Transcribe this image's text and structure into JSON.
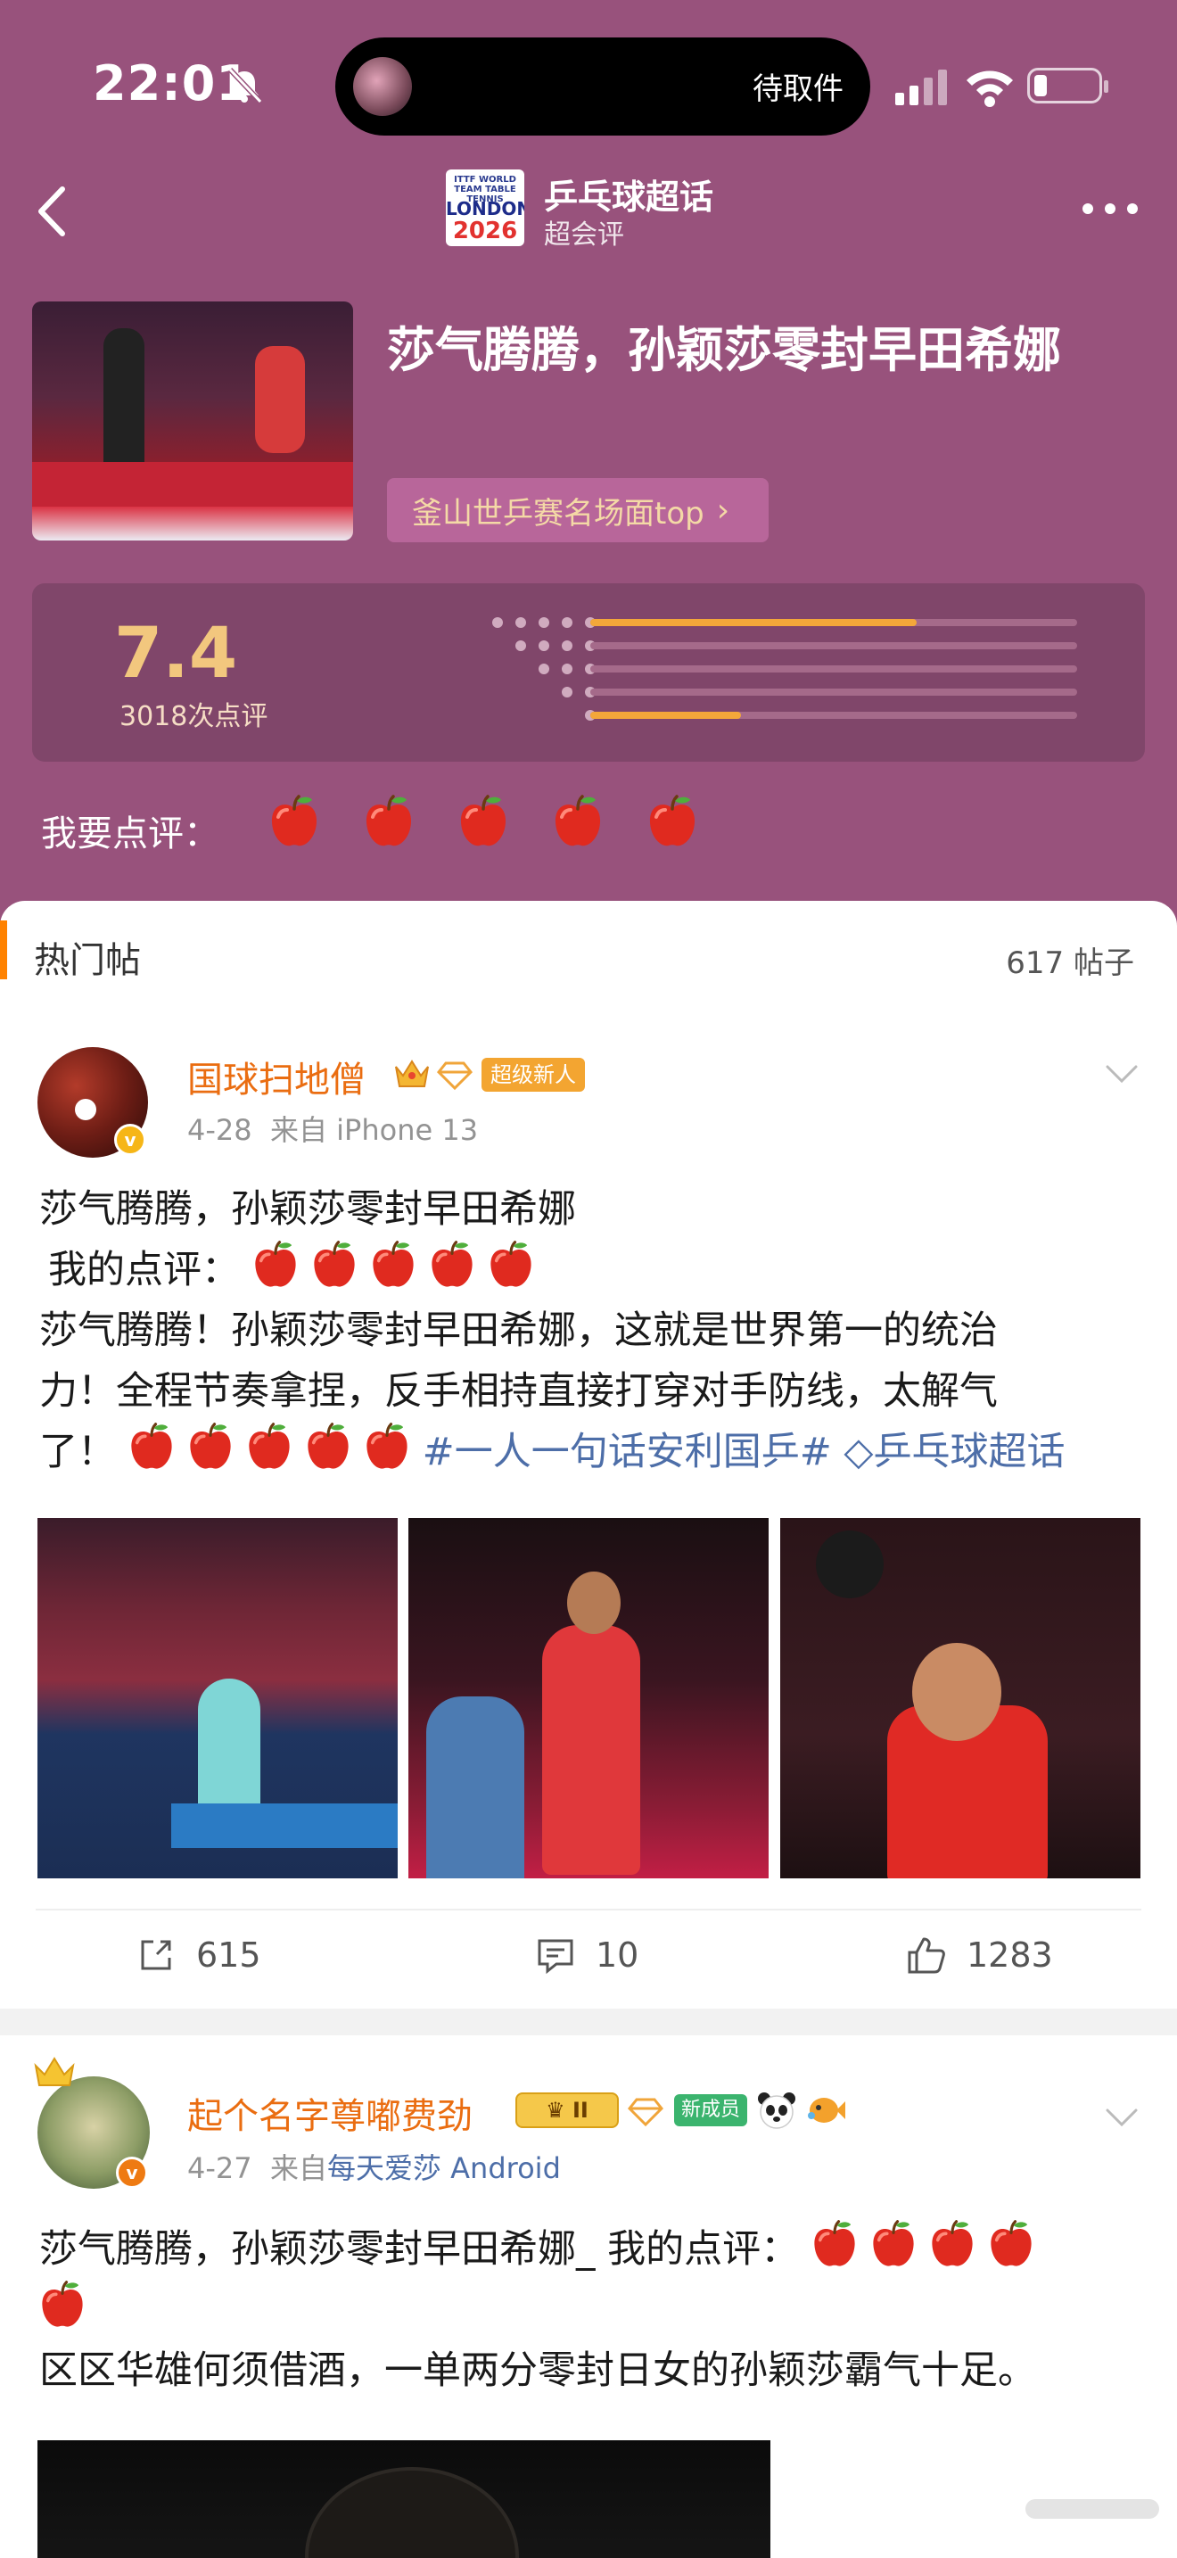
{
  "status_bar": {
    "time": "22:01",
    "island_text": "待取件"
  },
  "nav": {
    "topic_logo_line1": "ITTF WORLD TEAM TABLE TENNIS",
    "topic_logo_line2": "LONDON",
    "topic_logo_line3": "2026",
    "topic_name": "乒乓球超话",
    "topic_subtitle": "超会评"
  },
  "header": {
    "title": "莎气腾腾，孙颖莎零封早田希娜",
    "rank_chip": "釜山世乒赛名场面top",
    "score": "7.4",
    "rating_count": "3018次点评",
    "rating_distribution": [
      0.67,
      0.0,
      0.0,
      0.0,
      0.31
    ],
    "rate_label": "我要点评：",
    "rate_apples": 5
  },
  "feed": {
    "section_title": "热门帖",
    "post_count": "617 帖子",
    "posts": [
      {
        "username": "国球扫地僧",
        "badge": "超级新人",
        "date": "4-28",
        "source_prefix": "来自",
        "source": "iPhone 13",
        "title_line": "莎气腾腾，孙颖莎零封早田希娜",
        "review_label": "我的点评：",
        "review_apples": 5,
        "body_line1": "莎气腾腾！孙颖莎零封早田希娜，这就是世界第一的统治",
        "body_line2": "力！全程节奏拿捏，反手相持直接打穿对手防线，太解气",
        "body_line3_prefix": "了！",
        "body_apples": 5,
        "hashtag1": "#一人一句话安利国乒#",
        "hashtag2": "乒乓球超话",
        "shares": "615",
        "comments": "10",
        "likes": "1283"
      },
      {
        "username": "起个名字尊嘟费劲",
        "level_badge": "II",
        "badge": "新成员",
        "date": "4-27",
        "source_prefix": "来自",
        "source": "每天爱莎 Android",
        "line1": "莎气腾腾，孙颖莎零封早田希娜_ 我的点评：",
        "line1_apples": 4,
        "line2_apples": 1,
        "body": "区区华雄何须借酒，一单两分零封日女的孙颖莎霸气十足。"
      }
    ]
  },
  "colors": {
    "header_bg": "#98527c",
    "rating_box": "#80466a",
    "score": "#f2c77e",
    "accent_orange": "#ff8200",
    "username": "#ea6d11",
    "link_blue": "#4d6ea8",
    "bar_fill": "#f3a73a"
  },
  "icons": {
    "back": "chevron-left-icon",
    "more": "more-dots-icon",
    "rating_unit": "apple-icon",
    "share": "share-icon",
    "comment": "comment-icon",
    "like": "thumbs-up-icon",
    "verified": "verified-badge-icon",
    "crown": "crown-icon",
    "diamond": "diamond-icon",
    "mute": "bell-slash-icon"
  }
}
